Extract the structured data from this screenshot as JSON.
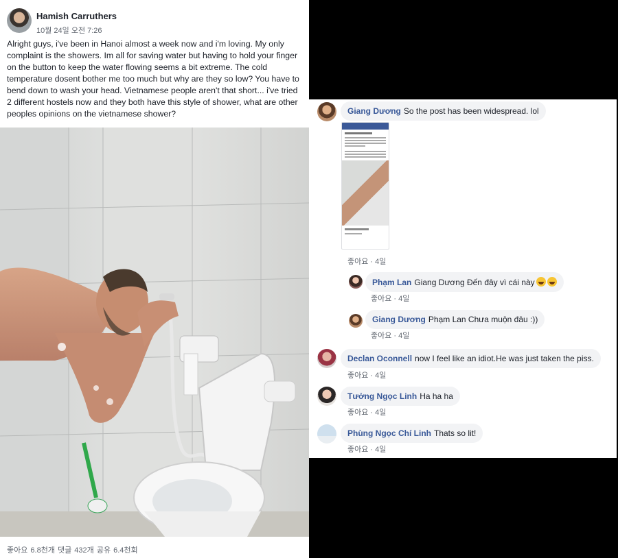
{
  "post": {
    "author": "Hamish Carruthers",
    "timestamp": "10월 24일 오전 7:26",
    "text": "Alright guys, i've been in Hanoi almost a week now and i'm loving. My only complaint is the showers. Im all for saving water but having to hold your finger on the button to keep the water flowing seems a bit extreme. The cold temperature dosent bother me too much but why are they so low? You have to bend down to wash your head. Vietnamese people aren't that short... i've tried 2 different hostels now and they both have this style of shower, what are other peoples opinions on the vietnamese shower?",
    "stats": "좋아요 6.8천개  댓글 432개  공유 6.4천회"
  },
  "comments": [
    {
      "name": "Giang Dương",
      "text": "So the post has been widespread. lol",
      "like": "좋아요",
      "age": "4일"
    },
    {
      "name": "Phạm Lan",
      "text": "Giang Dương Đến đây vì cái này",
      "like": "좋아요",
      "age": "4일"
    },
    {
      "name": "Giang Dương",
      "text": "Phạm Lan Chưa muộn đâu :))",
      "like": "좋아요",
      "age": "4일"
    },
    {
      "name": "Declan Oconnell",
      "text": "now I feel like an idiot.He was just taken the piss.",
      "like": "좋아요",
      "age": "4일"
    },
    {
      "name": "Tưởng Ngọc Linh",
      "text": "Ha ha ha",
      "like": "좋아요",
      "age": "4일"
    },
    {
      "name": "Phùng Ngọc Chí Linh",
      "text": "Thats so lit!",
      "like": "좋아요",
      "age": "4일"
    }
  ],
  "separator": " · ",
  "colors": {
    "fb_blue": "#385898",
    "bubble": "#f2f3f5",
    "text": "#1d2129",
    "meta": "#616770"
  }
}
